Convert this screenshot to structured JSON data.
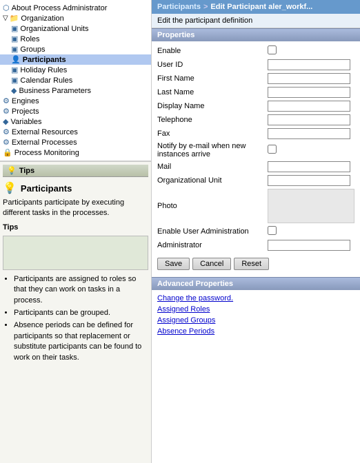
{
  "tree": {
    "items": [
      {
        "id": "about",
        "label": "About Process Administrator",
        "indent": 0,
        "icon": "ℹ",
        "selected": false
      },
      {
        "id": "organization",
        "label": "Organization",
        "indent": 0,
        "icon": "📁",
        "selected": false
      },
      {
        "id": "org-units",
        "label": "Organizational Units",
        "indent": 1,
        "icon": "🔷",
        "selected": false
      },
      {
        "id": "roles",
        "label": "Roles",
        "indent": 1,
        "icon": "🔷",
        "selected": false
      },
      {
        "id": "groups",
        "label": "Groups",
        "indent": 1,
        "icon": "🔷",
        "selected": false
      },
      {
        "id": "participants",
        "label": "Participants",
        "indent": 1,
        "icon": "👤",
        "selected": true
      },
      {
        "id": "holiday-rules",
        "label": "Holiday Rules",
        "indent": 1,
        "icon": "🔷",
        "selected": false
      },
      {
        "id": "calendar-rules",
        "label": "Calendar Rules",
        "indent": 1,
        "icon": "🔷",
        "selected": false
      },
      {
        "id": "business-params",
        "label": "Business Parameters",
        "indent": 1,
        "icon": "◆",
        "selected": false
      },
      {
        "id": "engines",
        "label": "Engines",
        "indent": 0,
        "icon": "⚙",
        "selected": false
      },
      {
        "id": "projects",
        "label": "Projects",
        "indent": 0,
        "icon": "⚙",
        "selected": false
      },
      {
        "id": "variables",
        "label": "Variables",
        "indent": 0,
        "icon": "◆",
        "selected": false
      },
      {
        "id": "ext-resources",
        "label": "External Resources",
        "indent": 0,
        "icon": "🔷",
        "selected": false
      },
      {
        "id": "ext-processes",
        "label": "External Processes",
        "indent": 0,
        "icon": "🔷",
        "selected": false
      },
      {
        "id": "proc-monitoring",
        "label": "Process Monitoring",
        "indent": 0,
        "icon": "🔒",
        "selected": false
      }
    ]
  },
  "tips": {
    "header": "Tips",
    "title": "Participants",
    "description": "Participants participate by executing different tasks in the processes.",
    "tips_label": "Tips",
    "list": [
      "Participants are assigned to roles so that they can work on tasks in a process.",
      "Participants can be grouped.",
      "Absence periods can be defined for participants so that replacement or substitute participants can be found to work on their tasks."
    ]
  },
  "breadcrumb": {
    "parts": [
      "Participants",
      ">",
      "Edit Participant aler_workf..."
    ]
  },
  "edit_description": "Edit the participant definition",
  "properties": {
    "header": "Properties",
    "fields": [
      {
        "label": "Enable",
        "type": "checkbox"
      },
      {
        "label": "User ID",
        "type": "text"
      },
      {
        "label": "First Name",
        "type": "text"
      },
      {
        "label": "Last Name",
        "type": "text"
      },
      {
        "label": "Display Name",
        "type": "text"
      },
      {
        "label": "Telephone",
        "type": "text"
      },
      {
        "label": "Fax",
        "type": "text"
      },
      {
        "label": "Notify by e-mail when new instances arrive",
        "type": "checkbox"
      },
      {
        "label": "Mail",
        "type": "text"
      },
      {
        "label": "Organizational Unit",
        "type": "text"
      },
      {
        "label": "Photo",
        "type": "photo"
      },
      {
        "label": "Enable User Administration",
        "type": "checkbox"
      },
      {
        "label": "Administrator",
        "type": "text"
      }
    ],
    "buttons": {
      "save": "Save",
      "cancel": "Cancel",
      "reset": "Reset"
    }
  },
  "advanced": {
    "header": "Advanced Properties",
    "links": [
      "Change the password.",
      "Assigned Roles",
      "Assigned Groups",
      "Absence Periods"
    ]
  }
}
